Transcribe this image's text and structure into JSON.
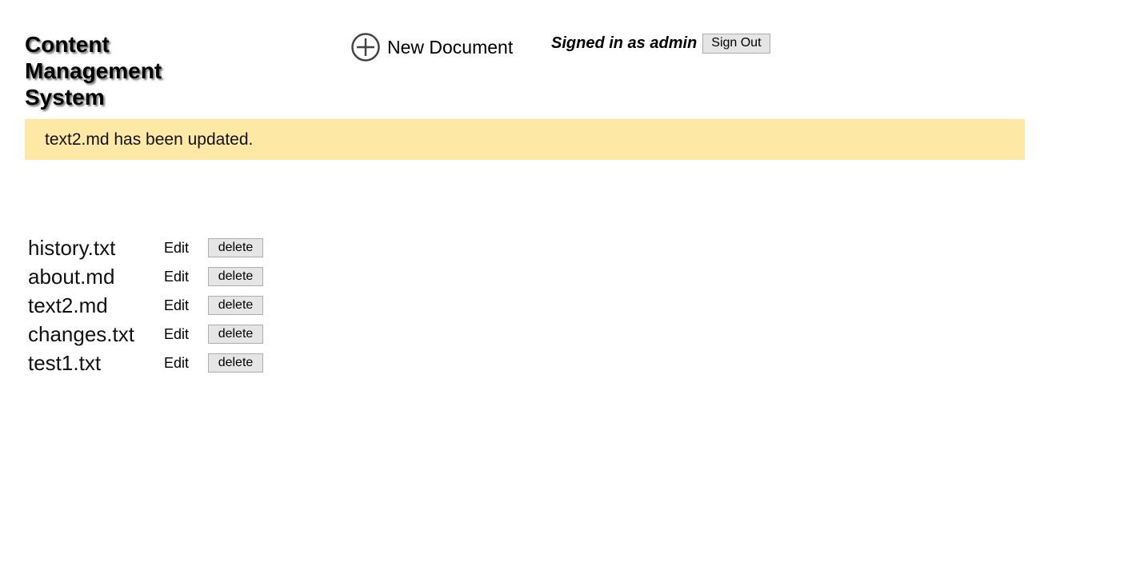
{
  "header": {
    "title": "Content Management System",
    "new_document_label": "New Document",
    "new_document_icon": "plus-circle-icon",
    "signed_in_text": "Signed in as admin",
    "sign_out_label": "Sign Out"
  },
  "flash": {
    "message": "text2.md has been updated.",
    "background_color": "#fde8a6"
  },
  "documents": [
    {
      "name": "history.txt",
      "edit_label": "Edit",
      "delete_label": "delete"
    },
    {
      "name": "about.md",
      "edit_label": "Edit",
      "delete_label": "delete"
    },
    {
      "name": "text2.md",
      "edit_label": "Edit",
      "delete_label": "delete"
    },
    {
      "name": "changes.txt",
      "edit_label": "Edit",
      "delete_label": "delete"
    },
    {
      "name": "test1.txt",
      "edit_label": "Edit",
      "delete_label": "delete"
    }
  ]
}
